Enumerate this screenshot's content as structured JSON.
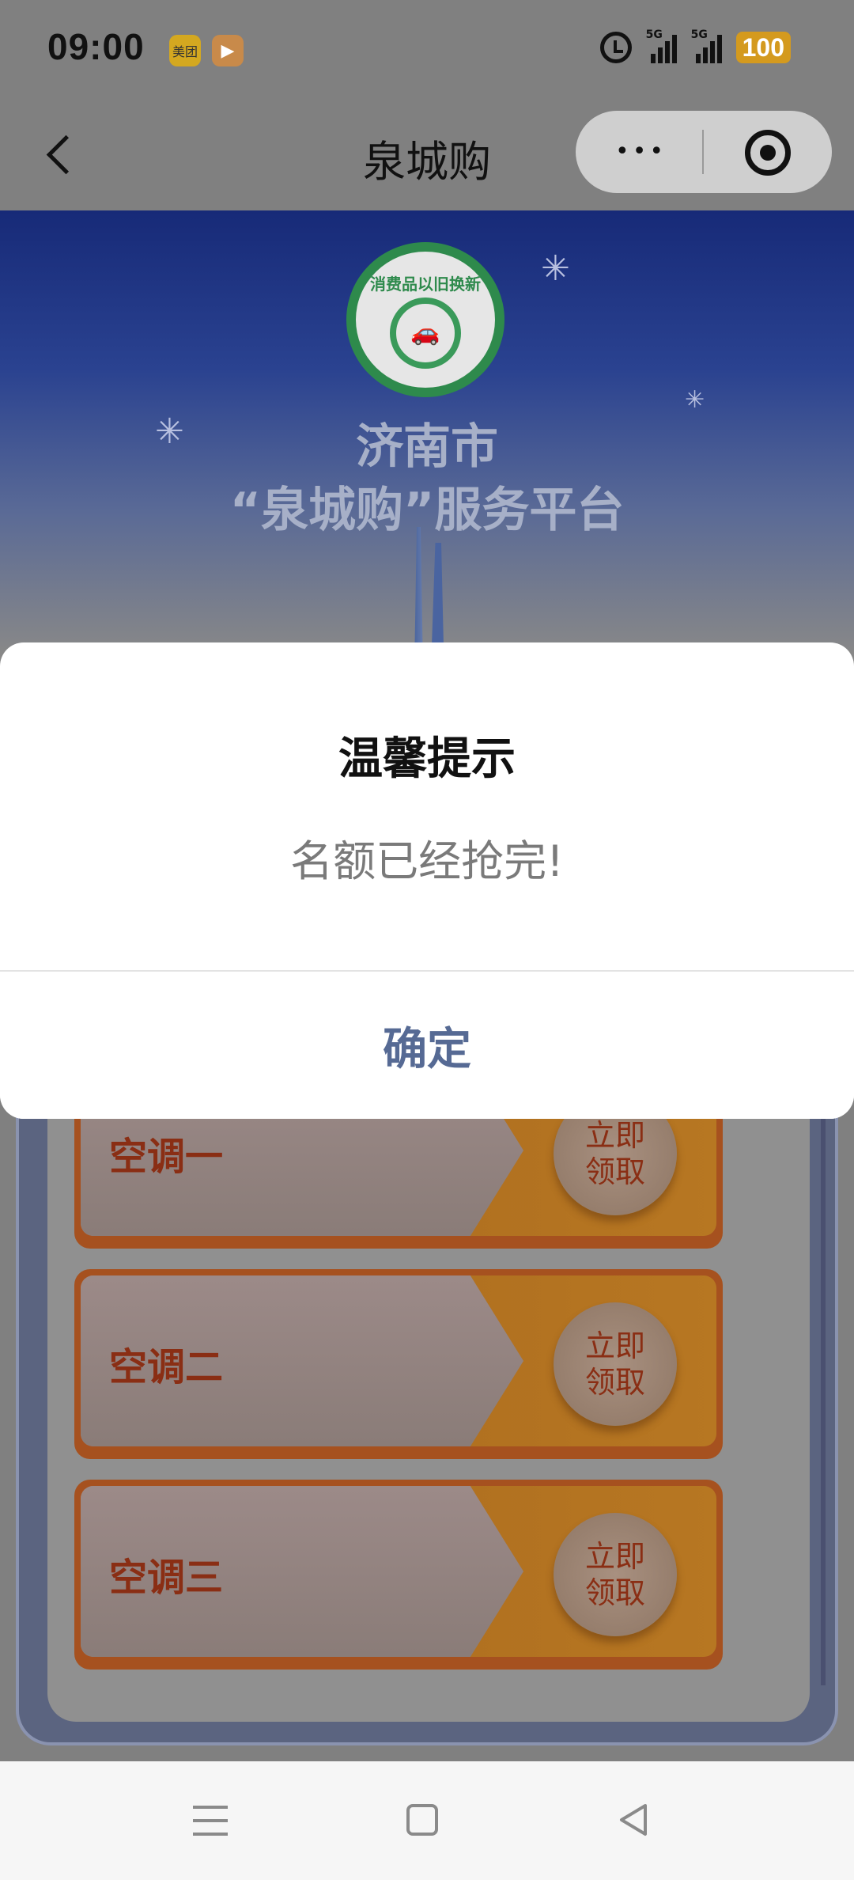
{
  "status_bar": {
    "time": "09:00",
    "app1": "美团",
    "signal1": "5G",
    "signal2": "5G",
    "battery": "100"
  },
  "nav": {
    "title": "泉城购",
    "menu_dots": "•••"
  },
  "hero": {
    "line1": "济南市",
    "line2": "“泉城购”服务平台",
    "logo_text": "消费品以旧换新"
  },
  "coupons": [
    {
      "name": "空调一",
      "claim": "立即领取"
    },
    {
      "name": "空调二",
      "claim": "立即领取"
    },
    {
      "name": "空调三",
      "claim": "立即领取"
    }
  ],
  "modal": {
    "title": "温馨提示",
    "message": "名额已经抢完!",
    "confirm": "确定"
  },
  "colors": {
    "confirm_text": "#566a94",
    "coupon_border": "#a6511f",
    "logo_green": "#2e8a4c"
  }
}
